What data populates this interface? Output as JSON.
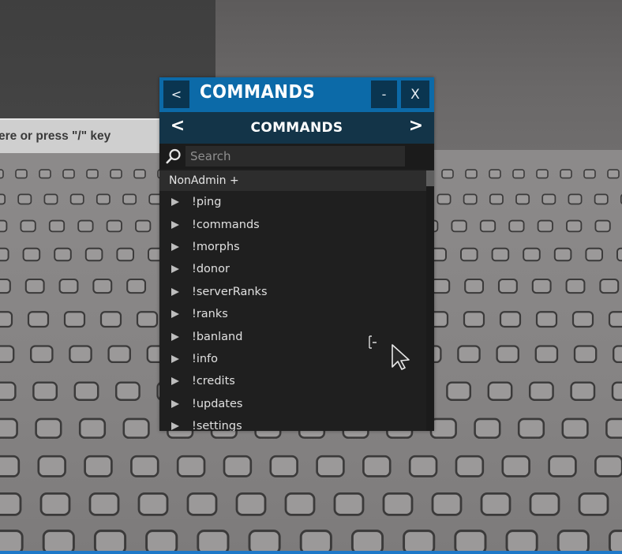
{
  "scene": {
    "chat_hint": "ere or press \"/\" key"
  },
  "window": {
    "title": "COMMANDS",
    "back_label": "<",
    "minimize_label": "-",
    "close_label": "X",
    "accent_color": "#0c6aa8"
  },
  "pagebar": {
    "title": "COMMANDS",
    "prev_label": "<",
    "next_label": ">"
  },
  "search": {
    "placeholder": "Search",
    "value": "",
    "icon": "search-icon"
  },
  "list": {
    "section": "NonAdmin +",
    "items": [
      {
        "label": "!ping"
      },
      {
        "label": "!commands"
      },
      {
        "label": "!morphs"
      },
      {
        "label": "!donor"
      },
      {
        "label": "!serverRanks"
      },
      {
        "label": "!ranks"
      },
      {
        "label": "!banland"
      },
      {
        "label": "!info"
      },
      {
        "label": "!credits"
      },
      {
        "label": "!updates"
      },
      {
        "label": "!settings"
      }
    ]
  }
}
